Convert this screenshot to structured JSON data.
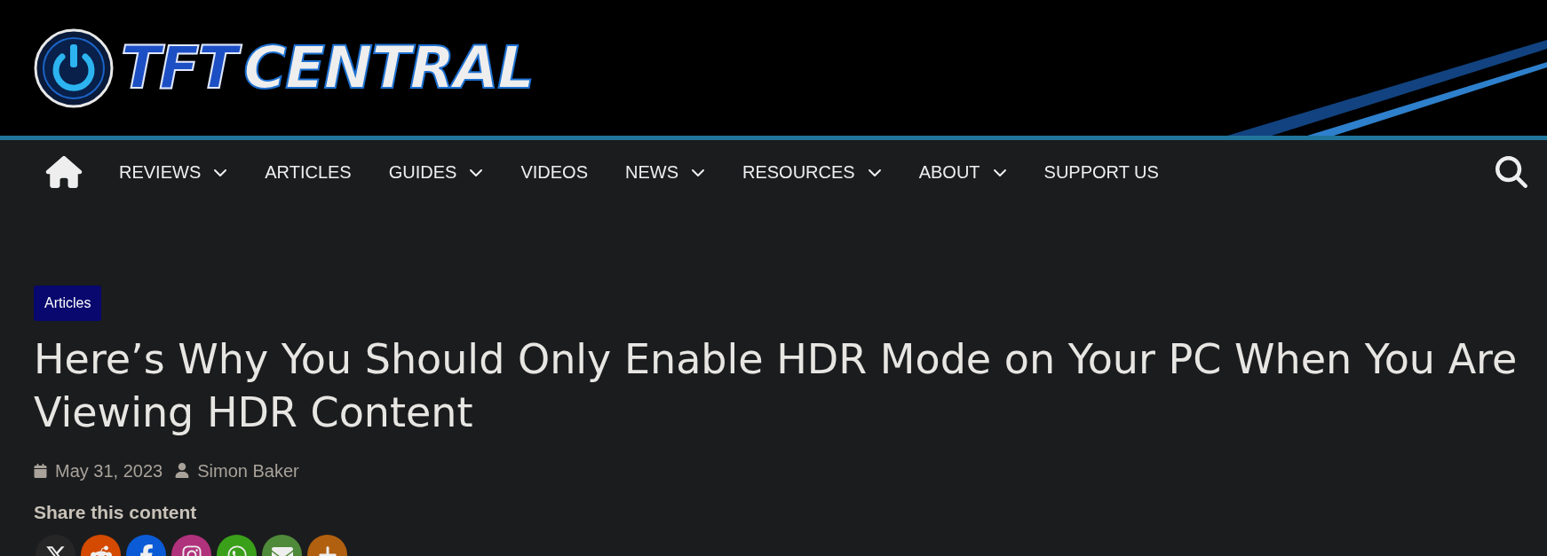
{
  "header": {
    "logo": {
      "part_1": "TFT",
      "part_2": "CENTRAL"
    }
  },
  "nav": {
    "items": [
      {
        "label": "REVIEWS",
        "has_dropdown": true
      },
      {
        "label": "ARTICLES",
        "has_dropdown": false
      },
      {
        "label": "GUIDES",
        "has_dropdown": true
      },
      {
        "label": "VIDEOS",
        "has_dropdown": false
      },
      {
        "label": "NEWS",
        "has_dropdown": true
      },
      {
        "label": "RESOURCES",
        "has_dropdown": true
      },
      {
        "label": "ABOUT",
        "has_dropdown": true
      },
      {
        "label": "SUPPORT US",
        "has_dropdown": false
      }
    ]
  },
  "article": {
    "category": "Articles",
    "title": "Here’s Why You Should Only Enable HDR Mode on Your PC When You Are Viewing HDR Content",
    "date": "May 31, 2023",
    "author": "Simon Baker"
  },
  "share": {
    "heading": "Share this content",
    "buttons": [
      {
        "kind": "x",
        "color": "#262626"
      },
      {
        "kind": "reddit",
        "color": "#d34a00"
      },
      {
        "kind": "facebook",
        "color": "#0b5bd6"
      },
      {
        "kind": "instagram",
        "color": "#b0327c"
      },
      {
        "kind": "whatsapp",
        "color": "#3aa01a"
      },
      {
        "kind": "email",
        "color": "#4f8a3a"
      },
      {
        "kind": "more",
        "color": "#b0600f"
      }
    ]
  }
}
